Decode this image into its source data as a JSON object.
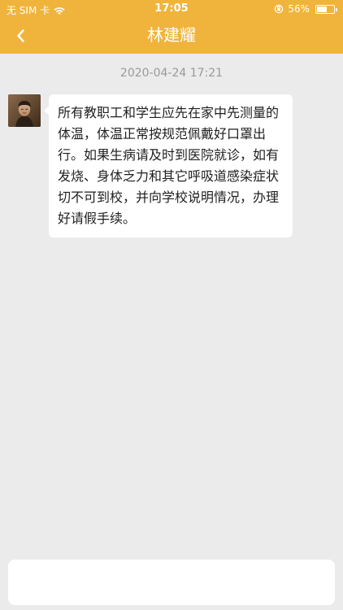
{
  "status_bar": {
    "carrier": "无 SIM 卡",
    "time": "17:05",
    "battery": "56%"
  },
  "header": {
    "title": "林建耀",
    "back_icon": "chevron-left-icon"
  },
  "conversation": {
    "timestamp": "2020-04-24 17:21",
    "messages": [
      {
        "text": "所有教职工和学生应先在家中先测量的体温，体温正常按规范佩戴好口罩出行。如果生病请及时到医院就诊，如有发烧、身体乏力和其它呼吸道感染症状切不可到校，并向学校说明情况，办理好请假手续。"
      }
    ]
  },
  "composer": {
    "value": "",
    "placeholder": ""
  },
  "colors": {
    "accent": "#f0b43c",
    "background": "#ebebeb",
    "bubble": "#ffffff"
  }
}
